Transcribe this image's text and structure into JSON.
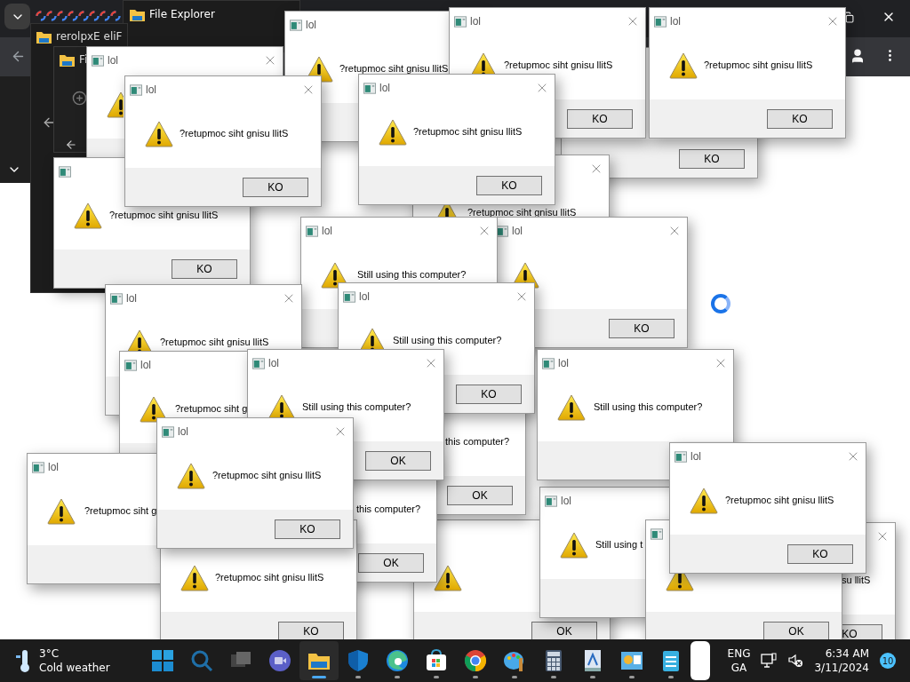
{
  "browser": {
    "tabs": [
      {
        "kind": "google"
      },
      {
        "kind": "google"
      },
      {
        "kind": "google"
      },
      {
        "kind": "google"
      },
      {
        "kind": "google"
      },
      {
        "kind": "google"
      },
      {
        "kind": "google"
      },
      {
        "kind": "google"
      }
    ]
  },
  "explorer_windows": [
    {
      "title": "File Explorer"
    },
    {
      "title": "rerolpxE eliF"
    },
    {
      "title": "Fi"
    }
  ],
  "dialogs": [
    {
      "title": "lol",
      "message": "?retupmoc siht gnisu llitS"
    },
    {
      "title": "lol",
      "message": "?retupmoc siht gnisu llitS",
      "button": "KO"
    },
    {
      "title": "lol",
      "message": "?retupmoc siht gnisu llitS",
      "button": "KO"
    },
    {
      "title": "lol"
    },
    {
      "button": "KO"
    },
    {
      "title": "lol",
      "message": "?retupmoc siht gnisu llitS",
      "button": "KO"
    },
    {
      "title": "lol",
      "message": "?retupmoc siht gnisu llitS",
      "button": "KO"
    },
    {
      "message": "?retupmoc siht gnisu llitS",
      "button": "KO"
    },
    {
      "message": "?retupmoc siht gnisu llitS"
    },
    {
      "title": "lol",
      "message": "Still using this computer?"
    },
    {
      "title": "lol",
      "button": "KO"
    },
    {
      "title": "lol",
      "message": "?retupmoc siht gnisu llitS"
    },
    {
      "title": "lol",
      "message": "Still using this computer?",
      "button": "KO"
    },
    {
      "title": "lol",
      "message": "?retupmoc siht g"
    },
    {
      "title": "lol",
      "message": "Still using this computer?",
      "button": "OK"
    },
    {
      "title": "lol",
      "message": "Still using this computer?"
    },
    {
      "message": "this computer?",
      "button": "OK"
    },
    {
      "title": "lol",
      "message": "?retupmoc siht gnisu llitS",
      "button": "KO"
    },
    {
      "title": "lol",
      "message": "?retupmoc siht g"
    },
    {
      "message": "this computer?",
      "button": "OK"
    },
    {
      "message": "?retupmoc siht gnisu llitS",
      "button": "KO"
    },
    {
      "title": "lol",
      "message": "Still using t"
    },
    {
      "title": "lol",
      "message": "?retupmoc siht gnisu llitS",
      "button": "KO"
    },
    {
      "button": "OK"
    },
    {
      "button": "OK"
    },
    {
      "message": "su llitS",
      "button": "KO"
    }
  ],
  "taskbar": {
    "temperature": "3°C",
    "weather": "Cold weather",
    "apps": [
      {
        "kind": "start",
        "open": false,
        "selected": false
      },
      {
        "kind": "search",
        "open": false,
        "selected": false
      },
      {
        "kind": "taskview",
        "open": false,
        "selected": false
      },
      {
        "kind": "meet",
        "open": false,
        "selected": false
      },
      {
        "kind": "explorer",
        "open": true,
        "selected": true
      },
      {
        "kind": "defender",
        "open": true,
        "selected": false
      },
      {
        "kind": "edge",
        "open": true,
        "selected": false
      },
      {
        "kind": "store",
        "open": true,
        "selected": false
      },
      {
        "kind": "chrome",
        "open": true,
        "selected": false
      },
      {
        "kind": "paint",
        "open": true,
        "selected": false
      },
      {
        "kind": "calculator",
        "open": true,
        "selected": false
      },
      {
        "kind": "wordpad",
        "open": true,
        "selected": false
      },
      {
        "kind": "control",
        "open": true,
        "selected": false
      },
      {
        "kind": "notepad",
        "open": true,
        "selected": false
      }
    ],
    "language": "ENG",
    "region": "GA",
    "time": "6:34 AM",
    "date": "3/11/2024",
    "notifications": "10"
  }
}
